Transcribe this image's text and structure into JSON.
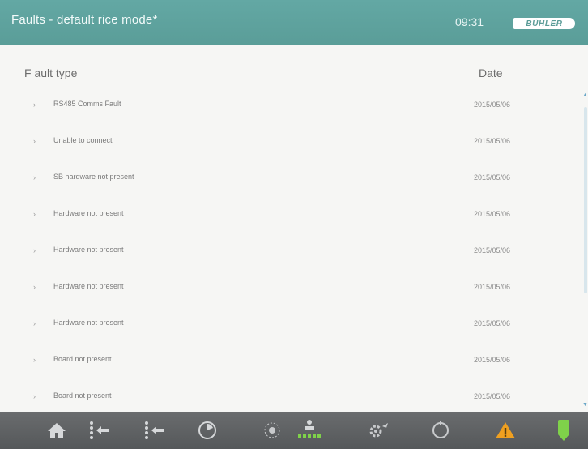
{
  "header": {
    "title": "Faults - default rice mode*",
    "time": "09:31",
    "logo_text": "BÜHLER"
  },
  "columns": {
    "fault_type": "F ault type",
    "date": "Date"
  },
  "faults": [
    {
      "label": "RS485 Comms Fault",
      "date": "2015/05/06"
    },
    {
      "label": "Unable to connect",
      "date": "2015/05/06"
    },
    {
      "label": "SB hardware not present",
      "date": "2015/05/06"
    },
    {
      "label": "Hardware not present",
      "date": "2015/05/06"
    },
    {
      "label": "Hardware not present",
      "date": "2015/05/06"
    },
    {
      "label": "Hardware not present",
      "date": "2015/05/06"
    },
    {
      "label": "Hardware not present",
      "date": "2015/05/06"
    },
    {
      "label": "Board not present",
      "date": "2015/05/06"
    },
    {
      "label": "Board not present",
      "date": "2015/05/06"
    }
  ],
  "toolbar": {
    "icons": [
      "home-icon",
      "ejector-back-icon",
      "ejector-back-icon-2",
      "gauge-icon",
      "settings-dots-icon",
      "sorter-icon",
      "gear-arrow-icon",
      "target-icon",
      "warning-icon",
      "stop-icon"
    ]
  },
  "colors": {
    "header": "#5ea29e",
    "toolbar": "#5e6062",
    "warning": "#f0a020",
    "ok_green": "#7fd24a"
  }
}
